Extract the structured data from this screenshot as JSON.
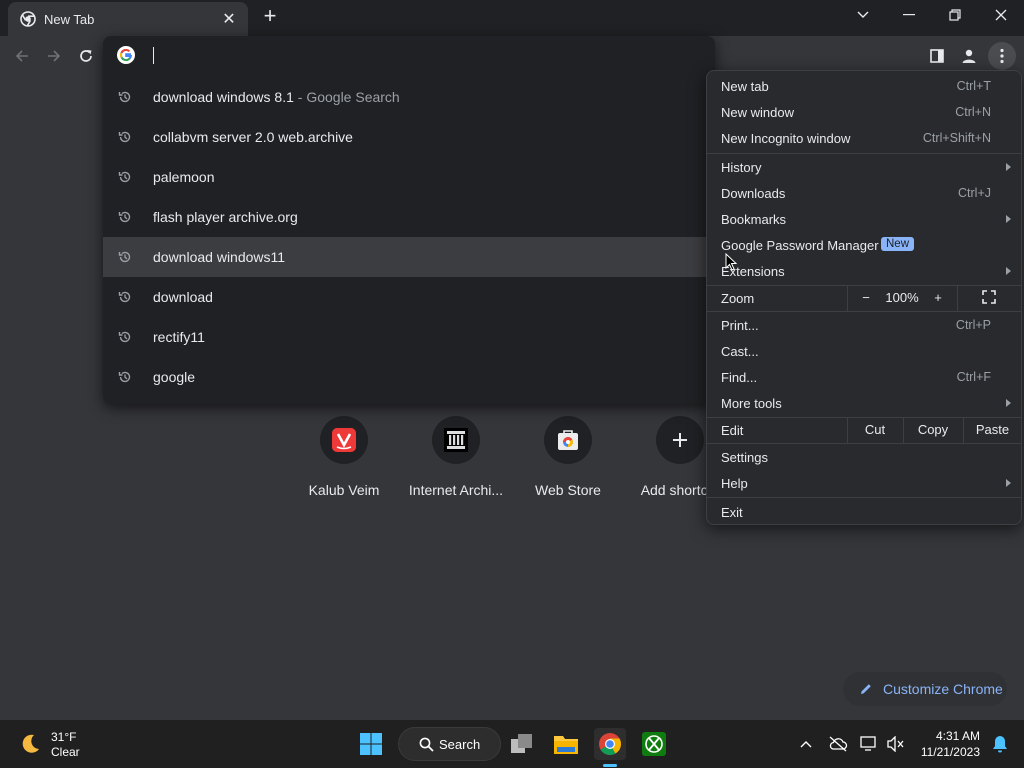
{
  "tab": {
    "title": "New Tab",
    "close_glyph": "✕",
    "new_glyph": "+"
  },
  "omnibox": {
    "suggestions": [
      {
        "text": "download windows 8.1",
        "sub": " - Google Search"
      },
      {
        "text": "collabvm server 2.0 web.archive",
        "sub": ""
      },
      {
        "text": "palemoon",
        "sub": ""
      },
      {
        "text": "flash player archive.org",
        "sub": ""
      },
      {
        "text": "download windows11",
        "sub": ""
      },
      {
        "text": "download",
        "sub": ""
      },
      {
        "text": "rectify11",
        "sub": ""
      },
      {
        "text": "google",
        "sub": ""
      }
    ]
  },
  "shortcuts": [
    {
      "label": "Kalub Veim"
    },
    {
      "label": "Internet Archi..."
    },
    {
      "label": "Web Store"
    },
    {
      "label": "Add shortcut"
    }
  ],
  "menu": {
    "new_tab": {
      "label": "New tab",
      "shortcut": "Ctrl+T"
    },
    "new_window": {
      "label": "New window",
      "shortcut": "Ctrl+N"
    },
    "new_incognito": {
      "label": "New Incognito window",
      "shortcut": "Ctrl+Shift+N"
    },
    "history": {
      "label": "History"
    },
    "downloads": {
      "label": "Downloads",
      "shortcut": "Ctrl+J"
    },
    "bookmarks": {
      "label": "Bookmarks"
    },
    "password_manager": {
      "label": "Google Password Manager",
      "badge": "New"
    },
    "extensions": {
      "label": "Extensions"
    },
    "zoom": {
      "label": "Zoom",
      "minus": "−",
      "value": "100%",
      "plus": "+"
    },
    "print": {
      "label": "Print...",
      "shortcut": "Ctrl+P"
    },
    "cast": {
      "label": "Cast..."
    },
    "find": {
      "label": "Find...",
      "shortcut": "Ctrl+F"
    },
    "more_tools": {
      "label": "More tools"
    },
    "edit": {
      "label": "Edit",
      "cut": "Cut",
      "copy": "Copy",
      "paste": "Paste"
    },
    "settings": {
      "label": "Settings"
    },
    "help": {
      "label": "Help"
    },
    "exit": {
      "label": "Exit"
    }
  },
  "customize": {
    "label": "Customize Chrome"
  },
  "taskbar": {
    "weather_temp": "31°F",
    "weather_cond": "Clear",
    "search_label": "Search",
    "time": "4:31 AM",
    "date": "11/21/2023"
  },
  "colors": {
    "accent": "#8ab4f8",
    "background": "#35363a",
    "menu_bg": "#292a2d"
  }
}
